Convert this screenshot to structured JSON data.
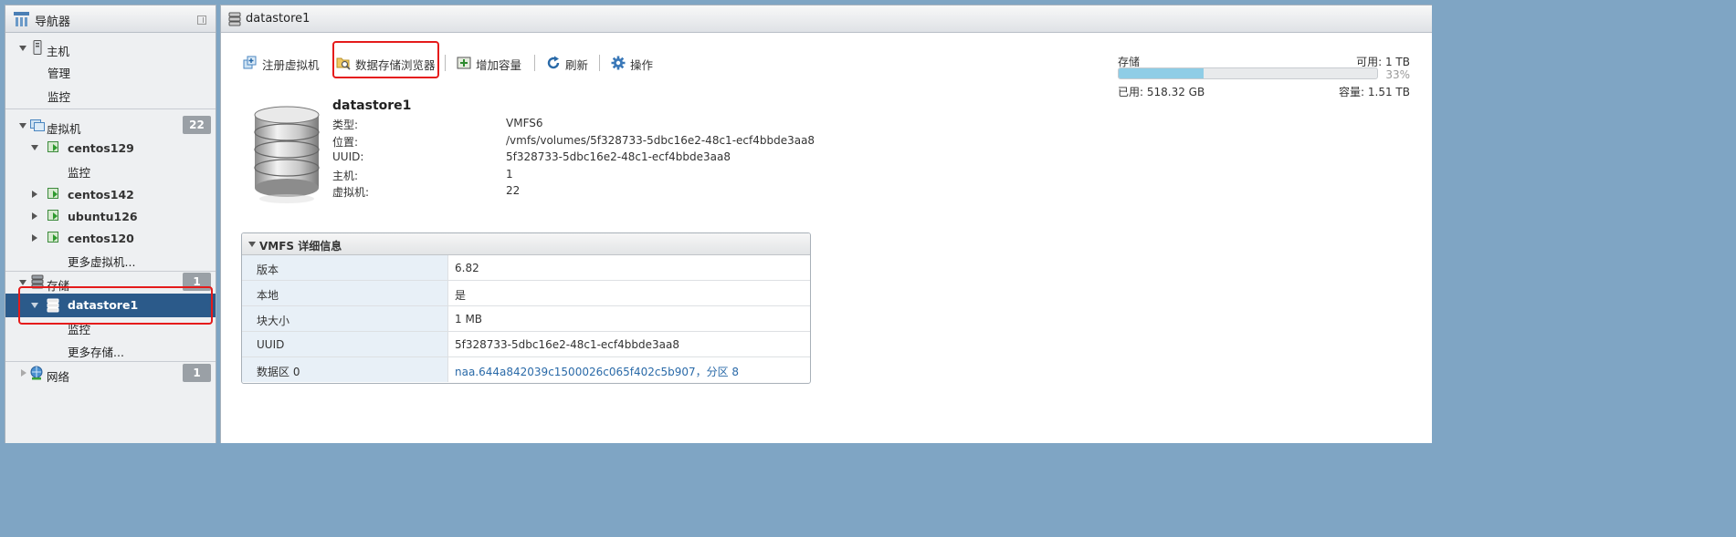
{
  "navigator": {
    "title": "导航器",
    "host": {
      "label": "主机",
      "children": [
        "管理",
        "监控"
      ]
    },
    "vms": {
      "label": "虚拟机",
      "count": "22",
      "items": [
        {
          "name": "centos129",
          "child": "监控"
        },
        {
          "name": "centos142"
        },
        {
          "name": "ubuntu126"
        },
        {
          "name": "centos120"
        }
      ],
      "more": "更多虚拟机..."
    },
    "storage": {
      "label": "存储",
      "count": "1",
      "selected": "datastore1",
      "selected_child": "监控",
      "more": "更多存储..."
    },
    "network": {
      "label": "网络",
      "count": "1"
    }
  },
  "main": {
    "title": "datastore1",
    "toolbar": {
      "register_vm": "注册虚拟机",
      "datastore_browser": "数据存储浏览器",
      "increase_capacity": "增加容量",
      "refresh": "刷新",
      "actions": "操作"
    },
    "info": {
      "name": "datastore1",
      "rows": [
        {
          "key": "类型:",
          "value": "VMFS6"
        },
        {
          "key": "位置:",
          "value": "/vmfs/volumes/5f328733-5dbc16e2-48c1-ecf4bbde3aa8"
        },
        {
          "key": "UUID:",
          "value": "5f328733-5dbc16e2-48c1-ecf4bbde3aa8"
        },
        {
          "key": "主机:",
          "value": "1"
        },
        {
          "key": "虚拟机:",
          "value": "22"
        }
      ]
    },
    "storage_summary": {
      "label": "存储",
      "free": "可用: 1 TB",
      "percent": "33%",
      "used_fraction": 0.33,
      "used": "已用: 518.32 GB",
      "capacity": "容量: 1.51 TB"
    },
    "vmfs": {
      "title": "VMFS 详细信息",
      "rows": [
        {
          "key": "版本",
          "value": "6.82"
        },
        {
          "key": "本地",
          "value": "是"
        },
        {
          "key": "块大小",
          "value": "1 MB"
        },
        {
          "key": "UUID",
          "value": "5f328733-5dbc16e2-48c1-ecf4bbde3aa8"
        },
        {
          "key": "数据区 0",
          "value": "naa.644a842039c1500026c065f402c5b907，分区 8"
        }
      ]
    }
  },
  "colors": {
    "selected_row": "#2b5a8a",
    "highlight": "#e51b1b",
    "usage_fill": "#8fcde6",
    "link": "#2a6aa8"
  }
}
